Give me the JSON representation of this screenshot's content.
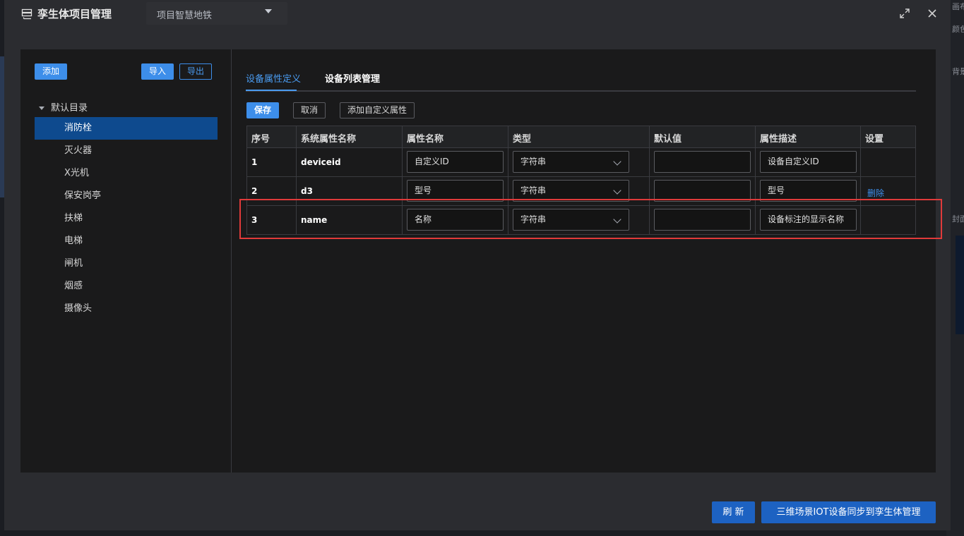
{
  "background": {
    "right_labels": [
      "画布",
      "颜色",
      "背景",
      "封面"
    ]
  },
  "header": {
    "title": "孪生体项目管理",
    "project_select": "项目智慧地铁"
  },
  "sidebar": {
    "add_label": "添加",
    "import_label": "导入",
    "export_label": "导出",
    "root_label": "默认目录",
    "items": [
      {
        "label": "消防栓",
        "active": true
      },
      {
        "label": "灭火器",
        "active": false
      },
      {
        "label": "X光机",
        "active": false
      },
      {
        "label": "保安岗亭",
        "active": false
      },
      {
        "label": "扶梯",
        "active": false
      },
      {
        "label": "电梯",
        "active": false
      },
      {
        "label": "闸机",
        "active": false
      },
      {
        "label": "烟感",
        "active": false
      },
      {
        "label": "摄像头",
        "active": false
      }
    ]
  },
  "main": {
    "tabs": [
      {
        "label": "设备属性定义",
        "active": true
      },
      {
        "label": "设备列表管理",
        "active": false
      }
    ],
    "toolbar": {
      "save_label": "保存",
      "cancel_label": "取消",
      "add_custom_label": "添加自定义属性"
    },
    "table": {
      "headers": [
        "序号",
        "系统属性名称",
        "属性名称",
        "类型",
        "默认值",
        "属性描述",
        "设置"
      ],
      "rows": [
        {
          "index": "1",
          "system_name": "deviceid",
          "name": "自定义ID",
          "type": "字符串",
          "default": "",
          "description": "设备自定义ID",
          "action": ""
        },
        {
          "index": "2",
          "system_name": "d3",
          "name": "型号",
          "type": "字符串",
          "default": "",
          "description": "型号",
          "action": "删除"
        },
        {
          "index": "3",
          "system_name": "name",
          "name": "名称",
          "type": "字符串",
          "default": "",
          "description": "设备标注的显示名称",
          "action": ""
        }
      ]
    }
  },
  "footer": {
    "refresh_label": "刷 新",
    "sync_label": "三维场景IOT设备同步到孪生体管理"
  },
  "colors": {
    "accent": "#3d8eea",
    "active_item": "#0e4a8e",
    "highlight_box": "#e03a3a"
  }
}
